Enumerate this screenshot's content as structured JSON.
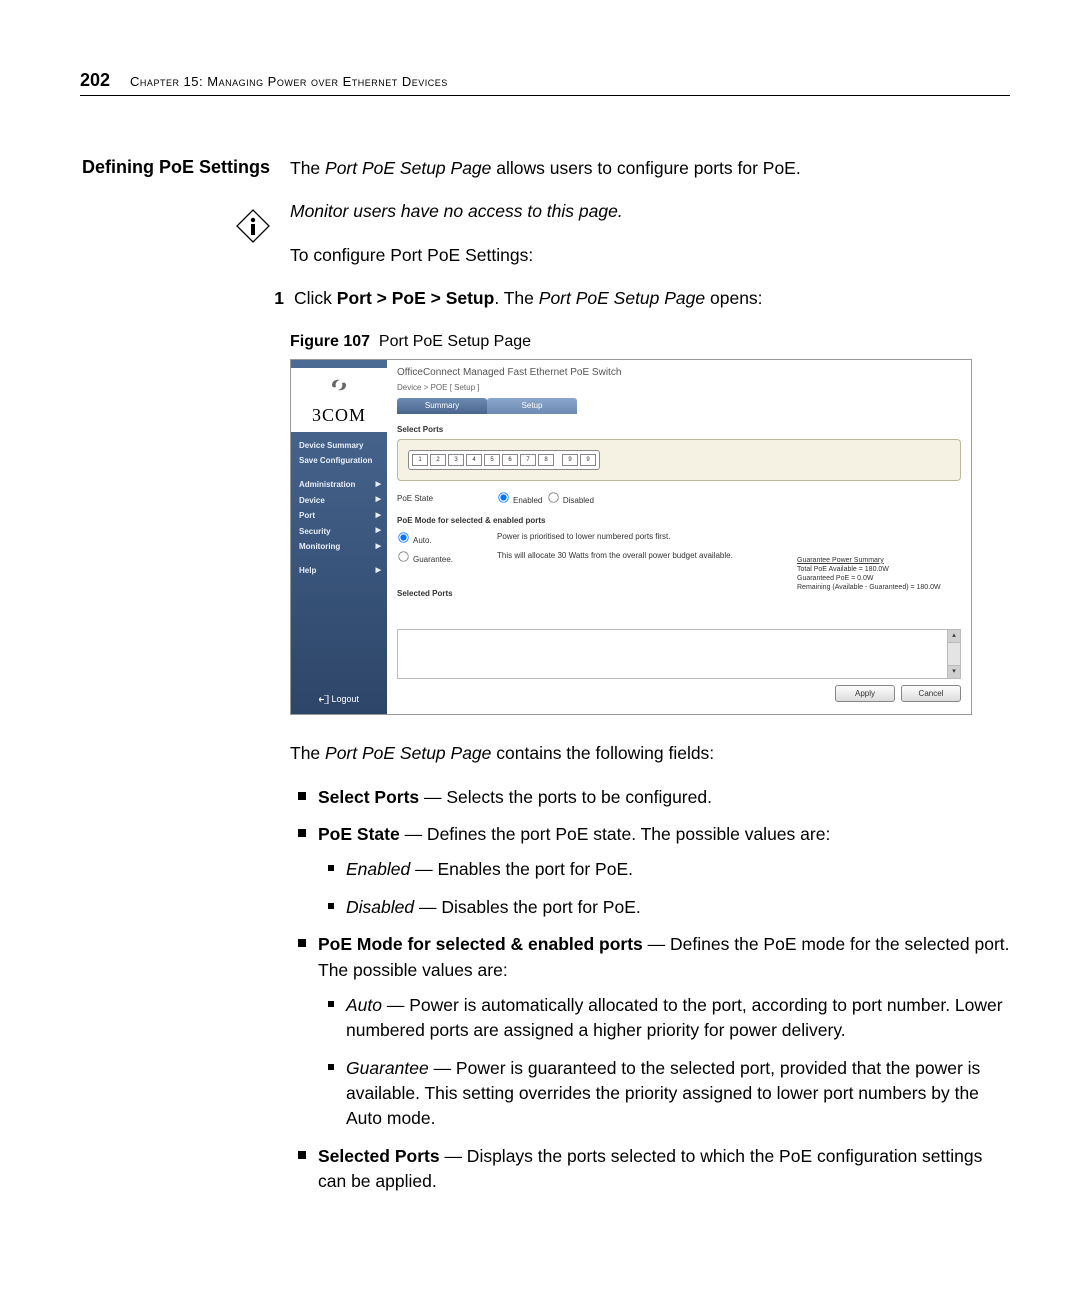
{
  "page_number": "202",
  "chapter_title": "Chapter 15: Managing Power over Ethernet Devices",
  "section_title": "Defining PoE Settings",
  "intro": "The ",
  "intro_em": "Port PoE Setup Page",
  "intro_tail": " allows users to configure ports for PoE.",
  "note": "Monitor users have no access to this page.",
  "to_configure": "To configure Port PoE Settings:",
  "step1_num": "1",
  "step1_a": "Click ",
  "step1_b": "Port > PoE > Setup",
  "step1_c": ". The ",
  "step1_em": "Port PoE Setup Page",
  "step1_d": " opens:",
  "fig_label": "Figure 107",
  "fig_title": "Port PoE Setup Page",
  "screenshot": {
    "device_title": "OfficeConnect Managed Fast Ethernet PoE Switch",
    "breadcrumb": "Device > POE [ Setup ]",
    "logo": "3COM",
    "nav": {
      "device_summary": "Device Summary",
      "save_config": "Save Configuration",
      "administration": "Administration",
      "device": "Device",
      "port": "Port",
      "security": "Security",
      "monitoring": "Monitoring",
      "help": "Help"
    },
    "logout": "Logout",
    "tabs": {
      "summary": "Summary",
      "setup": "Setup"
    },
    "select_ports_label": "Select Ports",
    "ports": [
      "1",
      "2",
      "3",
      "4",
      "5",
      "6",
      "7",
      "8",
      "9",
      "9"
    ],
    "poe_state_label": "PoE State",
    "poe_enabled": "Enabled",
    "poe_disabled": "Disabled",
    "mode_heading": "PoE Mode for selected & enabled ports",
    "mode_auto": "Auto.",
    "mode_auto_desc": "Power is prioritised to lower numbered ports first.",
    "mode_guarantee": "Guarantee.",
    "mode_guarantee_desc": "This will allocate 30 Watts from the overall power budget available.",
    "summary_title": "Guarantee Power Summary",
    "summary_l1": "Total PoE Available = 180.0W",
    "summary_l2": "Guaranteed PoE = 0.0W",
    "summary_l3": "Remaining (Available - Guaranteed) = 180.0W",
    "selected_ports": "Selected Ports",
    "apply": "Apply",
    "cancel": "Cancel"
  },
  "after_fig": "The ",
  "after_fig_em": "Port PoE Setup Page",
  "after_fig_tail": " contains the following fields:",
  "bullets": {
    "b1_title": "Select Ports",
    "b1_text": " — Selects the ports to be configured.",
    "b2_title": "PoE State",
    "b2_text": " — Defines the port PoE state. The possible values are:",
    "b2a_em": "Enabled",
    "b2a_text": " — Enables the port for PoE.",
    "b2b_em": "Disabled",
    "b2b_text": " — Disables the port for PoE.",
    "b3_title": "PoE Mode for selected & enabled ports",
    "b3_text": " — Defines the PoE mode for the selected port. The possible values are:",
    "b3a_em": "Auto",
    "b3a_text": " — Power is automatically allocated to the port, according to port number. Lower numbered ports are assigned a higher priority for power delivery.",
    "b3b_em": "Guarantee",
    "b3b_text": " — Power is guaranteed to the selected port, provided that the power is available. This setting overrides the priority assigned to lower port numbers by the Auto mode.",
    "b4_title": "Selected Ports",
    "b4_text": " — Displays the ports selected to which the PoE configuration settings can be applied."
  }
}
